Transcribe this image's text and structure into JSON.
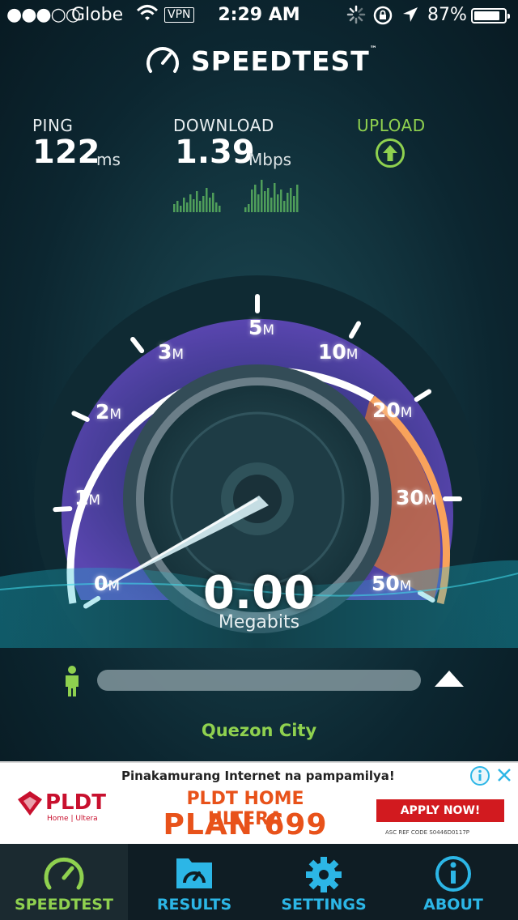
{
  "status_bar": {
    "signal": "●●●○○",
    "carrier": "Globe",
    "vpn": "VPN",
    "time": "2:29 AM",
    "battery": "87%",
    "battery_level": 0.87
  },
  "app": {
    "logo": "SPEEDTEST",
    "tm": "™"
  },
  "metrics": {
    "ping": {
      "label": "PING",
      "value": "122",
      "unit": "ms"
    },
    "download": {
      "label": "DOWNLOAD",
      "value": "1.39",
      "unit": "Mbps"
    },
    "upload": {
      "label": "UPLOAD",
      "icon": "arrow-up-circle-icon"
    }
  },
  "gauge": {
    "ticks": [
      {
        "num": "0",
        "unit": "M"
      },
      {
        "num": "1",
        "unit": "M"
      },
      {
        "num": "2",
        "unit": "M"
      },
      {
        "num": "3",
        "unit": "M"
      },
      {
        "num": "5",
        "unit": "M"
      },
      {
        "num": "10",
        "unit": "M"
      },
      {
        "num": "20",
        "unit": "M"
      },
      {
        "num": "30",
        "unit": "M"
      },
      {
        "num": "50",
        "unit": "M"
      }
    ],
    "speed": "0.00",
    "speed_unit": "Megabits",
    "accent_purple": "#6a4cc0",
    "accent_orange": "#f08a3c"
  },
  "progress": {
    "level": 0,
    "city": "Quezon City"
  },
  "ad": {
    "tagline": "Pinakamurang Internet na pampamilya!",
    "brand": "PLDT",
    "brand_sub": "Home | Ultera",
    "plan_line1": "PLDT HOME ULTERA",
    "plan_line2": "PLAN 699",
    "cta": "APPLY NOW!",
    "fine_print": "ASC REF CODE S0446D0117P"
  },
  "tabs": [
    {
      "label": "SPEEDTEST",
      "icon": "speedometer-icon",
      "active": true
    },
    {
      "label": "RESULTS",
      "icon": "folder-gauge-icon",
      "active": false
    },
    {
      "label": "SETTINGS",
      "icon": "gear-icon",
      "active": false
    },
    {
      "label": "ABOUT",
      "icon": "info-icon",
      "active": false
    }
  ],
  "colors": {
    "green": "#8fd14f",
    "blue": "#2cb6e6",
    "ad_red": "#c8102e"
  }
}
